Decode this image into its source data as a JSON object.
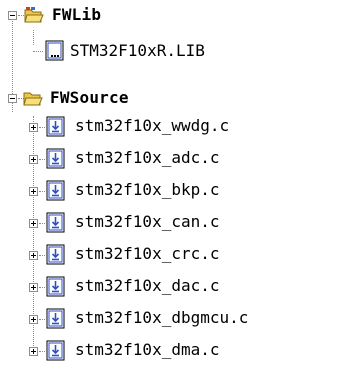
{
  "tree": {
    "fwlib": {
      "label": "FWLib",
      "expanded": true,
      "icon": "folder-open-icon"
    },
    "fwlib_children": [
      {
        "label": "STM32F10xR.LIB",
        "icon": "library-file-icon"
      }
    ],
    "fwsource": {
      "label": "FWSource",
      "expanded": true,
      "icon": "folder-open-icon"
    },
    "fwsource_children": [
      {
        "label": "stm32f10x_wwdg.c",
        "icon": "c-source-file-icon"
      },
      {
        "label": "stm32f10x_adc.c",
        "icon": "c-source-file-icon"
      },
      {
        "label": "stm32f10x_bkp.c",
        "icon": "c-source-file-icon"
      },
      {
        "label": "stm32f10x_can.c",
        "icon": "c-source-file-icon"
      },
      {
        "label": "stm32f10x_crc.c",
        "icon": "c-source-file-icon"
      },
      {
        "label": "stm32f10x_dac.c",
        "icon": "c-source-file-icon"
      },
      {
        "label": "stm32f10x_dbgmcu.c",
        "icon": "c-source-file-icon"
      },
      {
        "label": "stm32f10x_dma.c",
        "icon": "c-source-file-icon"
      }
    ]
  },
  "colors": {
    "folder_yellow": "#f2d75e",
    "folder_outline": "#9a7a1a",
    "file_blue": "#2f4fbf",
    "tree_line": "#8a8a8a"
  }
}
